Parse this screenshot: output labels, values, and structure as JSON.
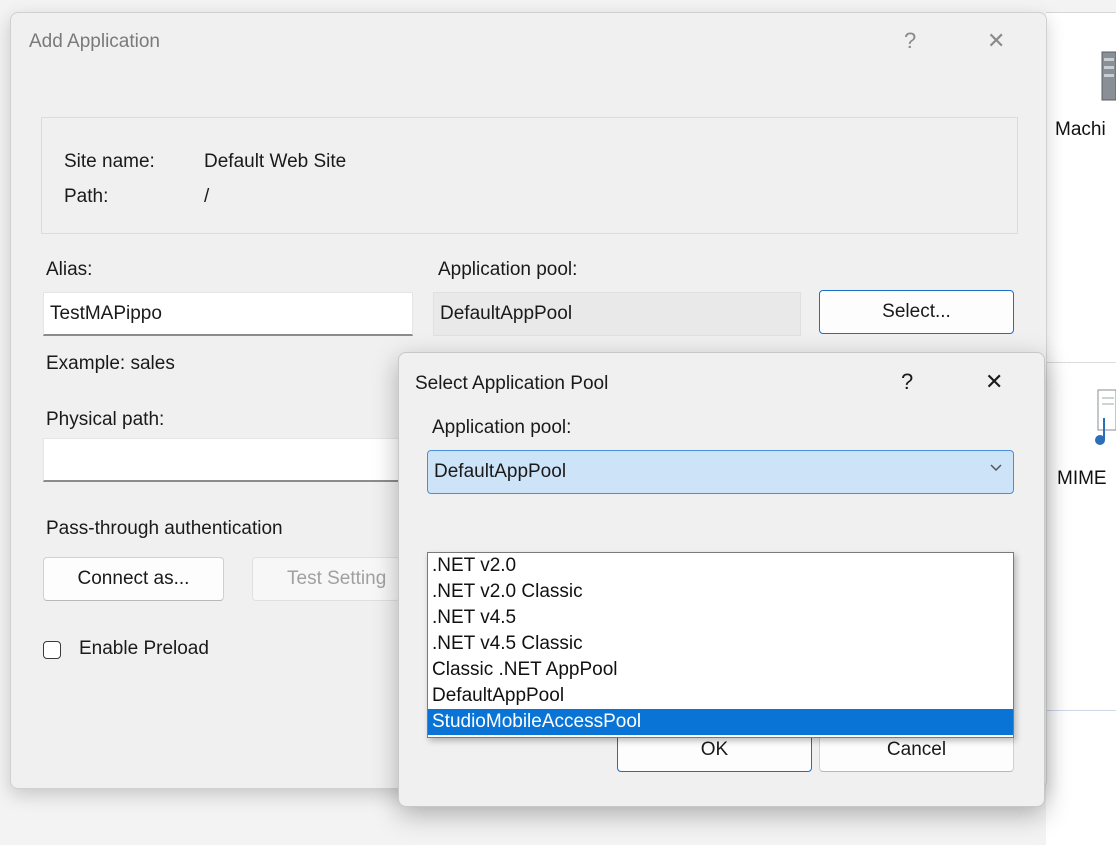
{
  "add_dialog": {
    "title": "Add Application",
    "help": "?",
    "close": "✕",
    "site_name_label": "Site name:",
    "site_name_value": "Default Web Site",
    "path_label": "Path:",
    "path_value": "/",
    "alias_label": "Alias:",
    "alias_value": "TestMAPippo",
    "app_pool_label": "Application pool:",
    "app_pool_value": "DefaultAppPool",
    "select_button": "Select...",
    "example_text": "Example: sales",
    "physical_path_label": "Physical path:",
    "physical_path_value": "",
    "pass_through_label": "Pass-through authentication",
    "connect_as_button": "Connect as...",
    "test_settings_button": "Test Setting",
    "enable_preload_label": "Enable Preload",
    "enable_preload_checked": false
  },
  "pool_dialog": {
    "title": "Select Application Pool",
    "help": "?",
    "close": "✕",
    "app_pool_label": "Application pool:",
    "selected_value": "DefaultAppPool",
    "options": [
      ".NET v2.0",
      ".NET v2.0 Classic",
      ".NET v4.5",
      ".NET v4.5 Classic",
      "Classic .NET AppPool",
      "DefaultAppPool",
      "StudioMobileAccessPool"
    ],
    "highlighted_option": "StudioMobileAccessPool",
    "ok_button": "OK",
    "cancel_button": "Cancel"
  },
  "background": {
    "icon_label_1": "Machi",
    "icon_label_2": "MIME"
  },
  "colors": {
    "accent": "#0a74d6",
    "select_bg": "#cde3f7",
    "dialog_bg": "#f0f0f0"
  }
}
